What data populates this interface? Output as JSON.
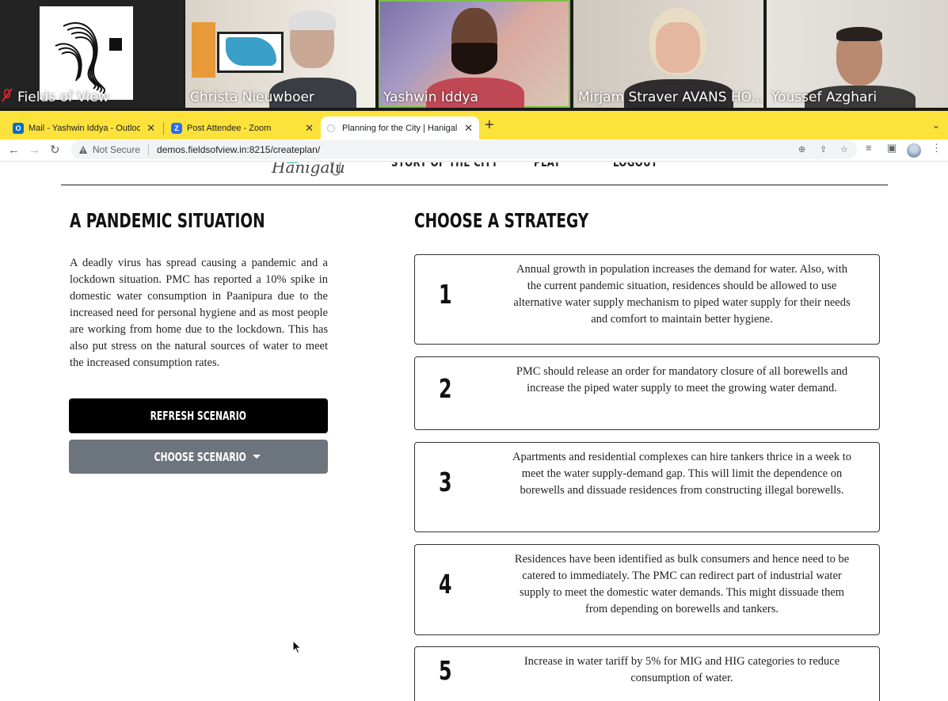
{
  "zoom": {
    "participants": [
      {
        "name": "Fields of View",
        "muted": true
      },
      {
        "name": "Christa Nieuwboer",
        "muted": false
      },
      {
        "name": "Yashwin Iddya",
        "muted": false,
        "active_speaker": true
      },
      {
        "name": "Mirjam Straver AVANS HO...",
        "muted": false
      },
      {
        "name": "Youssef Azghari",
        "muted": false
      }
    ]
  },
  "browser": {
    "tabs": [
      {
        "title": "Mail - Yashwin Iddya - Outlook",
        "icon": "outlook-icon",
        "color": "#0a6cc2"
      },
      {
        "title": "Post Attendee - Zoom",
        "icon": "zoom-icon",
        "color": "#2d6cf6"
      },
      {
        "title": "Planning for the City | Hanigalu",
        "icon": "site-icon",
        "active": true
      }
    ],
    "new_tab": "+",
    "security_label": "Not Secure",
    "url": "demos.fieldsofview.in:8215/createplan/"
  },
  "site": {
    "logo": "Hanigalu",
    "nav": [
      "STORY OF THE CITY",
      "PLAY",
      "LOGOUT"
    ]
  },
  "scenario": {
    "heading": "A PANDEMIC SITUATION",
    "text": "A deadly virus has spread causing a pandemic and a lockdown situation. PMC has reported a 10% spike in domestic water consumption in Paanipura due to the increased need for personal hygiene and as most people are working from home due to the lockdown. This has also put stress on the natural sources of water to meet the increased consumption rates.",
    "refresh_button": "REFRESH SCENARIO",
    "choose_button": "CHOOSE SCENARIO"
  },
  "strategy": {
    "heading": "CHOOSE A STRATEGY",
    "options": [
      {
        "number": "1",
        "text": "Annual growth in population increases the demand for water. Also, with the current pandemic situation, residences should be allowed to use alternative water supply mechanism to piped water supply for their needs and comfort to maintain better hygiene."
      },
      {
        "number": "2",
        "text": "PMC should release an order for mandatory closure of all borewells and increase the piped water supply to meet the growing water demand."
      },
      {
        "number": "3",
        "text": "Apartments and residential complexes can hire tankers thrice in a week to meet the water supply-demand gap. This will limit the dependence on borewells and dissuade residences from constructing illegal borewells."
      },
      {
        "number": "4",
        "text": "Residences have been identified as bulk consumers and hence need to be catered to immediately. The PMC can redirect part of industrial water supply to meet the domestic water demands. This might dissuade them from depending on borewells and tankers."
      },
      {
        "number": "5",
        "text": "Increase in water tariff by 5% for MIG and HIG categories to reduce consumption of water."
      }
    ]
  }
}
